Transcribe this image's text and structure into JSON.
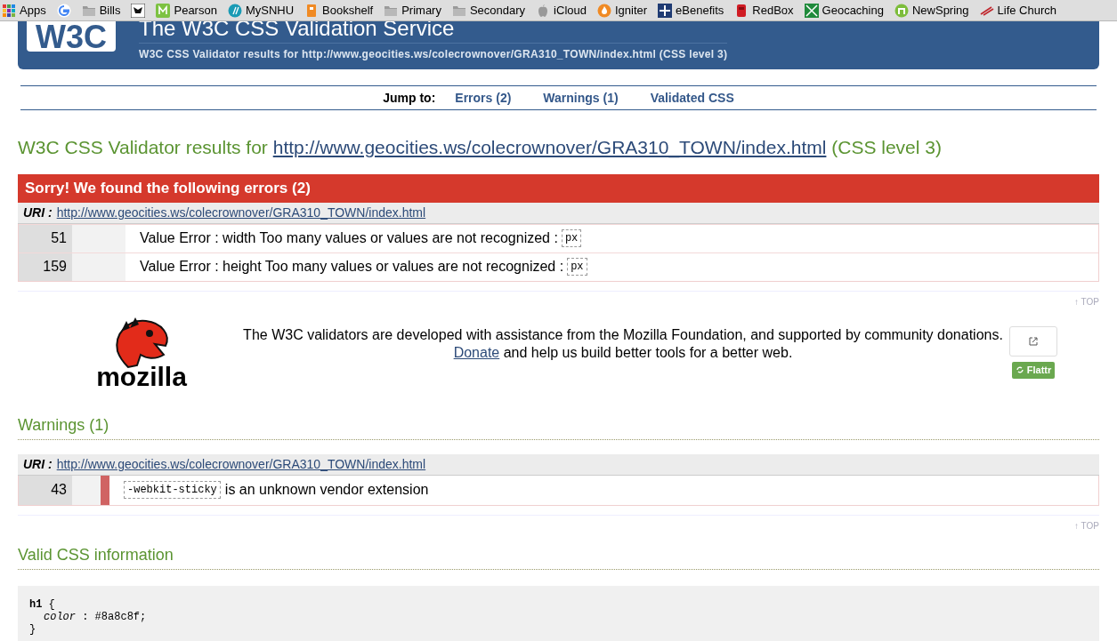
{
  "bookmarks": [
    {
      "label": "Apps",
      "kind": "apps"
    },
    {
      "kind": "google"
    },
    {
      "label": "Bills",
      "kind": "folder"
    },
    {
      "kind": "usaa"
    },
    {
      "label": "Pearson",
      "kind": "pearson"
    },
    {
      "label": "MySNHU",
      "kind": "snhu"
    },
    {
      "label": "Bookshelf",
      "kind": "bookshelf"
    },
    {
      "label": "Primary",
      "kind": "folder"
    },
    {
      "label": "Secondary",
      "kind": "folder"
    },
    {
      "label": "iCloud",
      "kind": "apple"
    },
    {
      "label": "Igniter",
      "kind": "igniter"
    },
    {
      "label": "eBenefits",
      "kind": "ebenefits"
    },
    {
      "label": "RedBox",
      "kind": "redbox"
    },
    {
      "label": "Geocaching",
      "kind": "geocaching"
    },
    {
      "label": "NewSpring",
      "kind": "newspring"
    },
    {
      "label": "Life Church",
      "kind": "lifechurch"
    }
  ],
  "header": {
    "logo": "W3C",
    "title": "The W3C CSS Validation Service",
    "subtitle": "W3C CSS Validator results for http://www.geocities.ws/colecrownover/GRA310_TOWN/index.html (CSS level 3)"
  },
  "jump": {
    "label": "Jump to:",
    "links": [
      "Errors (2)",
      "Warnings (1)",
      "Validated CSS"
    ]
  },
  "results_heading": {
    "prefix": "W3C CSS Validator results for",
    "url": "http://www.geocities.ws/colecrownover/GRA310_TOWN/index.html",
    "suffix": "(CSS level 3)"
  },
  "errors": {
    "title": "Sorry! We found the following errors (2)",
    "uri_label": "URI :",
    "uri": "http://www.geocities.ws/colecrownover/GRA310_TOWN/index.html",
    "rows": [
      {
        "line": "51",
        "message": "Value Error : width Too many values or values are not recognized :",
        "code": "px"
      },
      {
        "line": "159",
        "message": "Value Error : height Too many values or values are not recognized :",
        "code": "px"
      }
    ]
  },
  "top_links": [
    "↑ TOP",
    "↑ TOP"
  ],
  "sponsor": {
    "logo_text": "mozilla",
    "text": "The W3C validators are developed with assistance from the Mozilla Foundation, and supported by community donations.",
    "link": "Donate",
    "after": "and help us build better tools for a better web.",
    "flattr": "Flattr"
  },
  "warnings": {
    "heading": "Warnings (1)",
    "uri_label": "URI :",
    "uri": "http://www.geocities.ws/colecrownover/GRA310_TOWN/index.html",
    "rows": [
      {
        "line": "43",
        "code": "-webkit-sticky",
        "message": "is an unknown vendor extension"
      }
    ]
  },
  "valid": {
    "heading": "Valid CSS information",
    "code": [
      "**h1** {",
      "*color* : #8a8c8f;",
      "}"
    ]
  }
}
